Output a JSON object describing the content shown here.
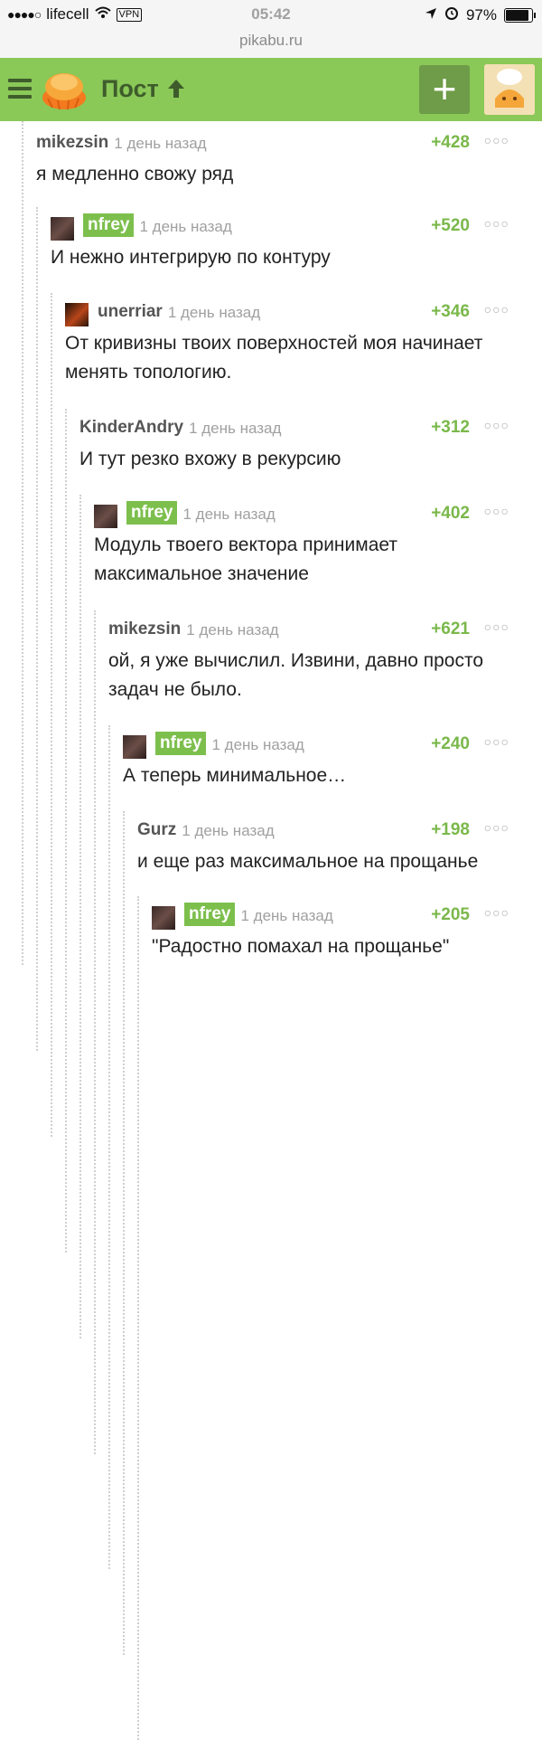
{
  "status": {
    "carrier": "lifecell",
    "vpn": "VPN",
    "time": "05:42",
    "battery": "97%",
    "battery_level": 0.97
  },
  "url": "pikabu.ru",
  "header": {
    "title": "Пост"
  },
  "comments": [
    {
      "author": "mikezsin",
      "time": "1 день назад",
      "rating": "+428",
      "text": "я медленно свожу ряд",
      "avatar": false,
      "tagged": false
    },
    {
      "author": "nfrey",
      "time": "1 день назад",
      "rating": "+520",
      "text": "И нежно интегрирую по контуру",
      "avatar": true,
      "tagged": true
    },
    {
      "author": "unerriar",
      "time": "1 день назад",
      "rating": "+346",
      "text": "От кривизны твоих поверхностей моя начинает менять топологию.",
      "avatar": true,
      "tagged": false
    },
    {
      "author": "KinderAndry",
      "time": "1 день назад",
      "rating": "+312",
      "text": "И тут резко вхожу в рекурсию",
      "avatar": false,
      "tagged": false
    },
    {
      "author": "nfrey",
      "time": "1 день назад",
      "rating": "+402",
      "text": "Модуль твоего вектора принимает максимальное значение",
      "avatar": true,
      "tagged": true
    },
    {
      "author": "mikezsin",
      "time": "1 день назад",
      "rating": "+621",
      "text": "ой, я уже вычислил. Извини, давно просто задач не было.",
      "avatar": false,
      "tagged": false
    },
    {
      "author": "nfrey",
      "time": "1 день назад",
      "rating": "+240",
      "text": "А теперь минимальное…",
      "avatar": true,
      "tagged": true
    },
    {
      "author": "Gurz",
      "time": "1 день назад",
      "rating": "+198",
      "text": "и еще раз максимальное на прощанье",
      "avatar": false,
      "tagged": false
    },
    {
      "author": "nfrey",
      "time": "1 день назад",
      "rating": "+205",
      "text": "\"Радостно помахал на прощанье\"",
      "avatar": true,
      "tagged": true
    }
  ],
  "colors": {
    "header": "#8ac858",
    "accent": "#7ab84a",
    "tag": "#7dbf4d"
  },
  "icons": {
    "menu": "hamburger-icon",
    "add": "plus-icon",
    "up": "arrow-up-icon",
    "more": "more-dots-icon"
  }
}
